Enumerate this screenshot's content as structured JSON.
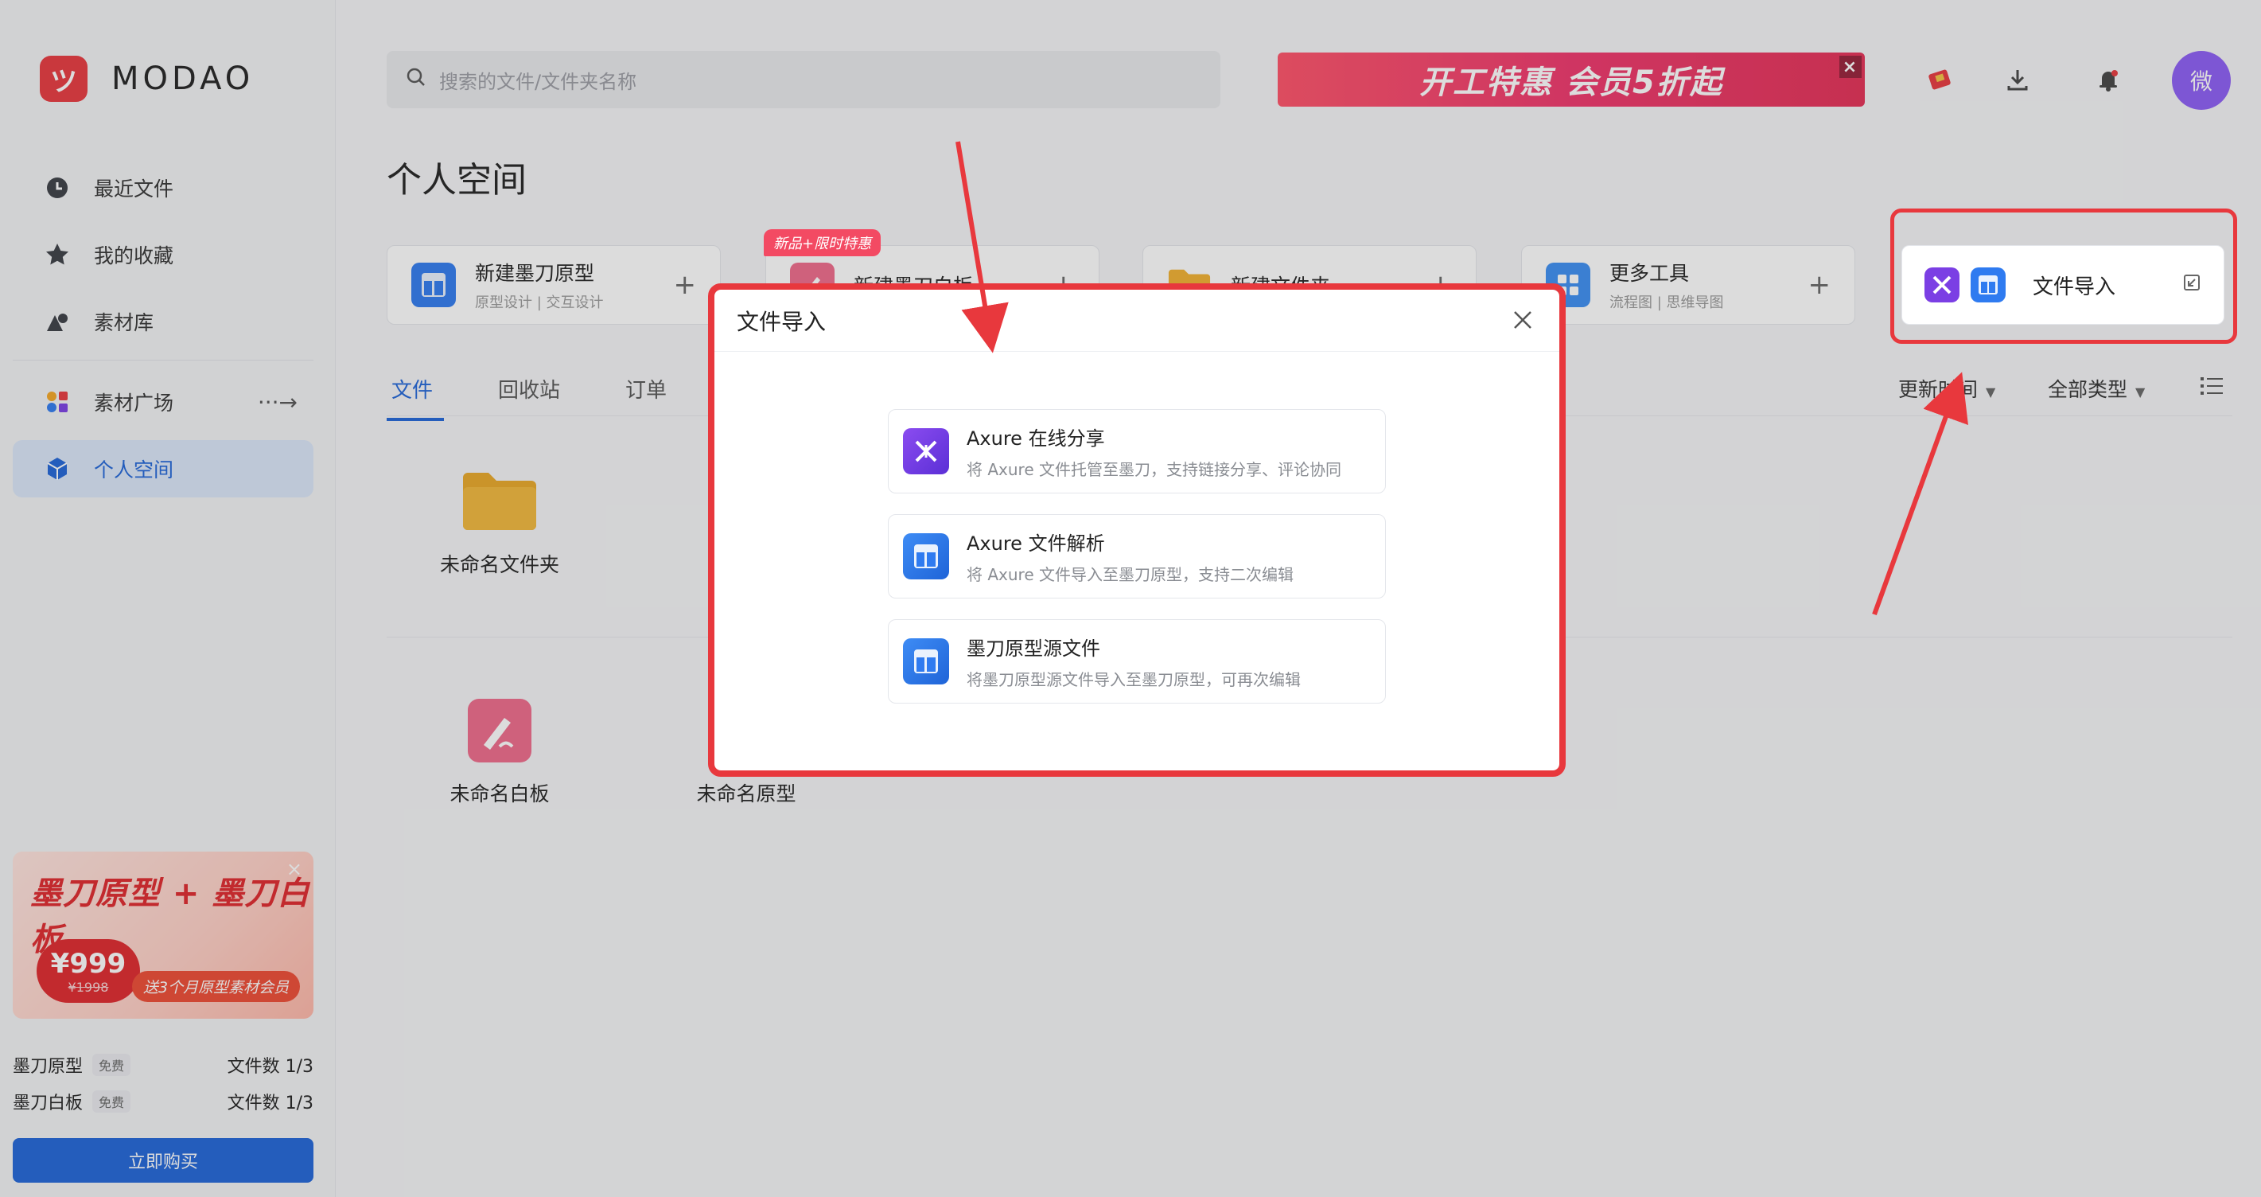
{
  "app": {
    "brand": "MODAO",
    "brand_mark": "ツ",
    "accent": "#1f64d8",
    "brand_red": "#e8383d"
  },
  "sidebar": {
    "items": [
      {
        "label": "最近文件",
        "icon": "clock-icon"
      },
      {
        "label": "我的收藏",
        "icon": "star-icon"
      },
      {
        "label": "素材库",
        "icon": "shapes-icon"
      },
      {
        "label": "素材广场",
        "icon": "palette-icon",
        "arrow": "···→"
      },
      {
        "label": "个人空间",
        "icon": "cube-icon",
        "active": true
      }
    ],
    "promo": {
      "title": "墨刀原型 + 墨刀白板",
      "price": "¥999",
      "old_price": "¥1998",
      "subtitle": "送3个月原型素材会员"
    },
    "plans": [
      {
        "name": "墨刀原型",
        "tag": "免费",
        "count": "文件数 1/3"
      },
      {
        "name": "墨刀白板",
        "tag": "免费",
        "count": "文件数 1/3"
      }
    ],
    "buy_label": "立即购买"
  },
  "header": {
    "search_placeholder": "搜索的文件/文件夹名称",
    "banner_text": "开工特惠 会员5折起",
    "avatar_text": "微"
  },
  "main": {
    "title": "个人空间",
    "new_badge": "新品+限时特惠",
    "cards": [
      {
        "title": "新建墨刀原型",
        "subtitle": "原型设计 | 交互设计"
      },
      {
        "title": "新建墨刀白板",
        "subtitle": ""
      },
      {
        "title": "新建文件夹",
        "subtitle": ""
      },
      {
        "title": "更多工具",
        "subtitle": "流程图 | 思维导图"
      }
    ],
    "import_card": {
      "label": "文件导入"
    },
    "tabs": [
      "文件",
      "回收站",
      "订单"
    ],
    "filters": {
      "sort": "更新时间",
      "type": "全部类型"
    },
    "folders": [
      {
        "name": "未命名文件夹"
      }
    ],
    "files": [
      {
        "name": "未命名白板"
      },
      {
        "name": "未命名原型"
      }
    ]
  },
  "dialog": {
    "title": "文件导入",
    "options": [
      {
        "title": "Axure 在线分享",
        "desc": "将 Axure 文件托管至墨刀，支持链接分享、评论协同",
        "icon": "axure-share-icon",
        "color": "#7b3fe4"
      },
      {
        "title": "Axure 文件解析",
        "desc": "将 Axure 文件导入至墨刀原型，支持二次编辑",
        "icon": "prototype-icon",
        "color": "#2f7bf0"
      },
      {
        "title": "墨刀原型源文件",
        "desc": "将墨刀原型源文件导入至墨刀原型，可再次编辑",
        "icon": "prototype-source-icon",
        "color": "#2f7bf0"
      }
    ]
  }
}
